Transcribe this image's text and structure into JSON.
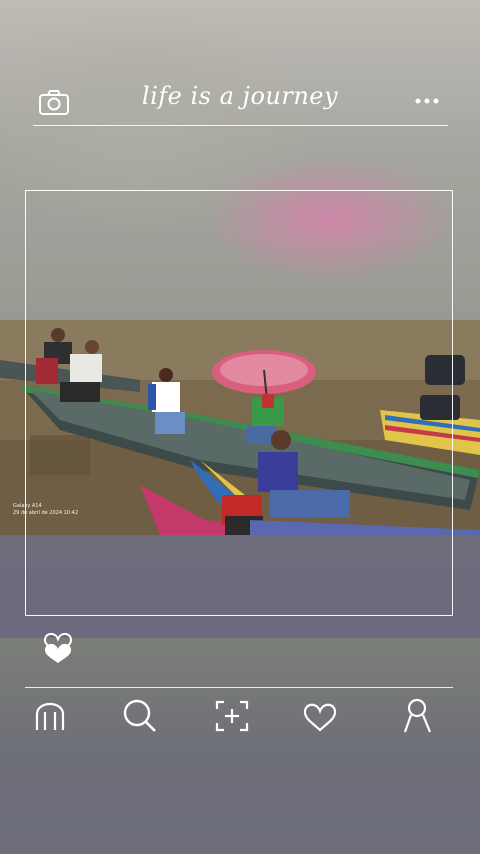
{
  "header": {
    "title": "life is a journey",
    "camera_icon": "camera-icon",
    "more_icon": "more-dots-icon"
  },
  "photo": {
    "meta_line1": "Galaxy A14",
    "meta_line2": "29 de abril de 2024 10:42"
  },
  "actions": {
    "like_icon": "heart-icon"
  },
  "bottom_nav": {
    "items": [
      {
        "icon": "home-icon"
      },
      {
        "icon": "search-icon"
      },
      {
        "icon": "add-icon"
      },
      {
        "icon": "heart-outline-icon"
      },
      {
        "icon": "profile-icon"
      }
    ]
  },
  "colors": {
    "overlay_line": "#ffffff",
    "icon": "#ffffff"
  }
}
